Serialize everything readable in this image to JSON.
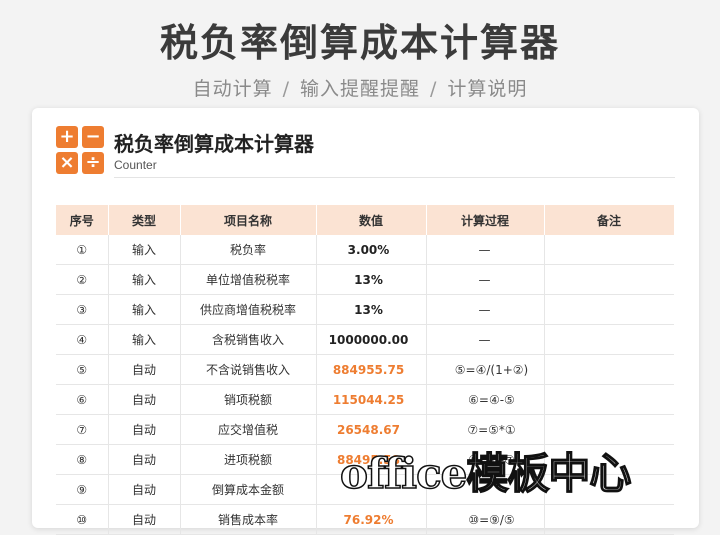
{
  "header": {
    "title": "税负率倒算成本计算器",
    "subtitle_parts": [
      "自动计算",
      "输入提醒提醒",
      "计算说明"
    ],
    "separator": "/"
  },
  "card": {
    "title": "税负率倒算成本计算器",
    "subtitle": "Counter",
    "logo_keys": [
      "+",
      "−",
      "×",
      "÷"
    ]
  },
  "table": {
    "columns": [
      "序号",
      "类型",
      "项目名称",
      "数值",
      "计算过程",
      "备注"
    ],
    "rows": [
      {
        "no": "①",
        "type": "输入",
        "name": "税负率",
        "value": "3.00%",
        "formula": "—",
        "note": ""
      },
      {
        "no": "②",
        "type": "输入",
        "name": "单位增值税税率",
        "value": "13%",
        "formula": "—",
        "note": ""
      },
      {
        "no": "③",
        "type": "输入",
        "name": "供应商增值税税率",
        "value": "13%",
        "formula": "—",
        "note": ""
      },
      {
        "no": "④",
        "type": "输入",
        "name": "含税销售收入",
        "value": "1000000.00",
        "formula": "—",
        "note": ""
      },
      {
        "no": "⑤",
        "type": "自动",
        "name": "不含说销售收入",
        "value": "884955.75",
        "formula": "⑤=④/(1+②)",
        "note": ""
      },
      {
        "no": "⑥",
        "type": "自动",
        "name": "销项税额",
        "value": "115044.25",
        "formula": "⑥=④-⑤",
        "note": ""
      },
      {
        "no": "⑦",
        "type": "自动",
        "name": "应交增值税",
        "value": "26548.67",
        "formula": "⑦=⑤*①",
        "note": ""
      },
      {
        "no": "⑧",
        "type": "自动",
        "name": "进项税额",
        "value": "88495.58",
        "formula": "⑧=⑥-⑦",
        "note": ""
      },
      {
        "no": "⑨",
        "type": "自动",
        "name": "倒算成本金额",
        "value": "",
        "formula": "",
        "note": ""
      },
      {
        "no": "⑩",
        "type": "自动",
        "name": "销售成本率",
        "value": "76.92%",
        "formula": "⑩=⑨/⑤",
        "note": ""
      }
    ]
  },
  "watermark": "office模板中心",
  "colors": {
    "accent": "#ee7d31",
    "header_bg": "#fbe3d3"
  }
}
